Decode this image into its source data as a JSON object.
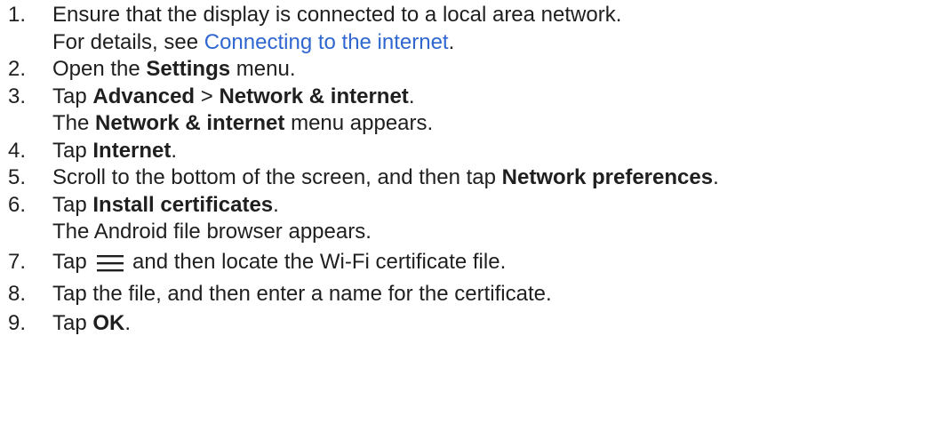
{
  "steps": [
    {
      "number": "1.",
      "text_a": "Ensure that the display is connected to a local area network.",
      "sub_a": "For details, see ",
      "link": "Connecting to the internet",
      "sub_b": "."
    },
    {
      "number": "2.",
      "text_a": "Open the ",
      "bold_a": "Settings",
      "text_b": " menu."
    },
    {
      "number": "3.",
      "text_a": "Tap ",
      "bold_a": "Advanced",
      "text_b": " > ",
      "bold_b": "Network & internet",
      "text_c": ".",
      "sub_a": "The ",
      "sub_bold": "Network & internet",
      "sub_b": " menu appears."
    },
    {
      "number": "4.",
      "text_a": "Tap ",
      "bold_a": "Internet",
      "text_b": "."
    },
    {
      "number": "5.",
      "text_a": "Scroll to the bottom of the screen, and then tap ",
      "bold_a": "Network preferences",
      "text_b": "."
    },
    {
      "number": "6.",
      "text_a": "Tap ",
      "bold_a": "Install certificates",
      "text_b": ".",
      "sub_a": "The Android file browser appears."
    },
    {
      "number": "7.",
      "text_a": "Tap ",
      "icon": "menu-icon",
      "text_b": " and then locate the Wi-Fi certificate file."
    },
    {
      "number": "8.",
      "text_a": "Tap the file, and then enter a name for the certificate."
    },
    {
      "number": "9.",
      "text_a": "Tap ",
      "bold_a": "OK",
      "text_b": "."
    }
  ],
  "colors": {
    "text": "#1f1f1f",
    "link": "#2f66d0"
  }
}
